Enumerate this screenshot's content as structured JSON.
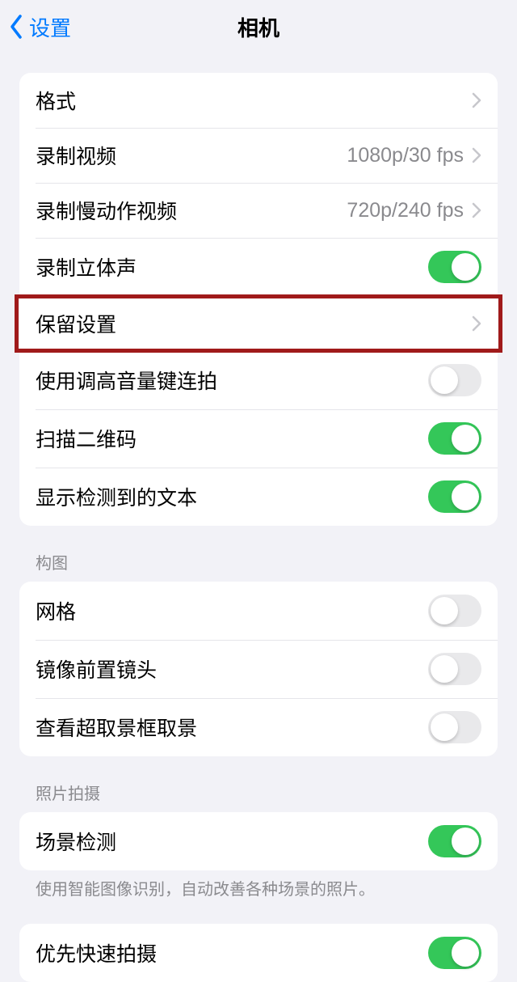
{
  "nav": {
    "back_label": "设置",
    "title": "相机"
  },
  "group1": {
    "rows": [
      {
        "label": "格式",
        "type": "nav"
      },
      {
        "label": "录制视频",
        "value": "1080p/30 fps",
        "type": "nav"
      },
      {
        "label": "录制慢动作视频",
        "value": "720p/240 fps",
        "type": "nav"
      },
      {
        "label": "录制立体声",
        "type": "toggle",
        "on": true
      },
      {
        "label": "保留设置",
        "type": "nav",
        "highlighted": true
      },
      {
        "label": "使用调高音量键连拍",
        "type": "toggle",
        "on": false
      },
      {
        "label": "扫描二维码",
        "type": "toggle",
        "on": true
      },
      {
        "label": "显示检测到的文本",
        "type": "toggle",
        "on": true
      }
    ]
  },
  "group2": {
    "header": "构图",
    "rows": [
      {
        "label": "网格",
        "type": "toggle",
        "on": false
      },
      {
        "label": "镜像前置镜头",
        "type": "toggle",
        "on": false
      },
      {
        "label": "查看超取景框取景",
        "type": "toggle",
        "on": false
      }
    ]
  },
  "group3": {
    "header": "照片拍摄",
    "rows": [
      {
        "label": "场景检测",
        "type": "toggle",
        "on": true
      }
    ],
    "footer": "使用智能图像识别，自动改善各种场景的照片。"
  },
  "group4": {
    "rows": [
      {
        "label": "优先快速拍摄",
        "type": "toggle",
        "on": true
      }
    ]
  }
}
